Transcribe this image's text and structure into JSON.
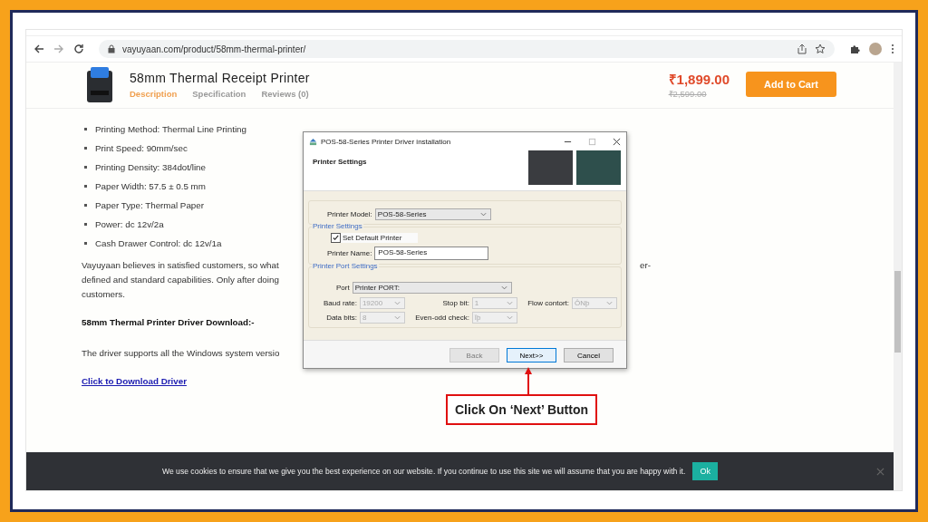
{
  "browser": {
    "url": "vayuyaan.com/product/58mm-thermal-printer/"
  },
  "product": {
    "title": "58mm Thermal Receipt Printer",
    "price": "₹1,899.00",
    "old_price": "₹2,599.00",
    "cart_button": "Add to Cart",
    "tabs": [
      {
        "label": "Description",
        "selected": true
      },
      {
        "label": "Specification",
        "selected": false
      },
      {
        "label": "Reviews (0)",
        "selected": false
      }
    ]
  },
  "specs": [
    "Printing Method: Thermal Line Printing",
    "Print Speed: 90mm/sec",
    "Printing Density: 384dot/line",
    "Paper Width: 57.5 ± 0.5 mm",
    "Paper Type: Thermal Paper",
    "Power: dc 12v/2a",
    "Cash Drawer Control: dc 12v/1a"
  ],
  "paragraph": {
    "lines": [
      "Vayuyaan believes in satisfied customers, so what",
      "defined and standard capabilities. Only after doing",
      "customers."
    ],
    "right_fragment": "er-"
  },
  "download_heading": "58mm Thermal Printer Driver Download:-",
  "driver_text": "The driver supports all the Windows system versio",
  "download_link": "Click to Download Driver",
  "dialog": {
    "title": "POS-58-Series Printer Driver installation",
    "header": "Printer Settings",
    "model_label": "Printer Model:",
    "model_value": "POS-58-Series",
    "settings_group": "Printer Settings",
    "default_printer": {
      "label": "Set Default Printer",
      "checked": true
    },
    "name_label": "Printer Name:",
    "name_value": "POS-58-Series",
    "port_group": "Printer Port Settings",
    "port_label": "Port",
    "port_value": "Printer PORT:",
    "fields": [
      {
        "label": "Baud rate:",
        "value": "19200",
        "disabled": true
      },
      {
        "label": "Stop bit:",
        "value": "1",
        "disabled": true
      },
      {
        "label": "Flow contort:",
        "value": "ÔNþ",
        "disabled": true
      },
      {
        "label": "Data bits:",
        "value": "8",
        "disabled": true
      },
      {
        "label": "Even-odd check:",
        "value": "Ïþ",
        "disabled": true
      }
    ],
    "buttons": [
      {
        "label": "Back",
        "disabled": true,
        "focused": false
      },
      {
        "label": "Next>>",
        "disabled": false,
        "focused": true
      },
      {
        "label": "Cancel",
        "disabled": false,
        "focused": false
      }
    ]
  },
  "callout": "Click On ‘Next’ Button",
  "cookie": {
    "text": "We use cookies to ensure that we give you the best experience on our website. If you continue to use this site we will assume that you are happy with it.",
    "button": "Ok"
  }
}
